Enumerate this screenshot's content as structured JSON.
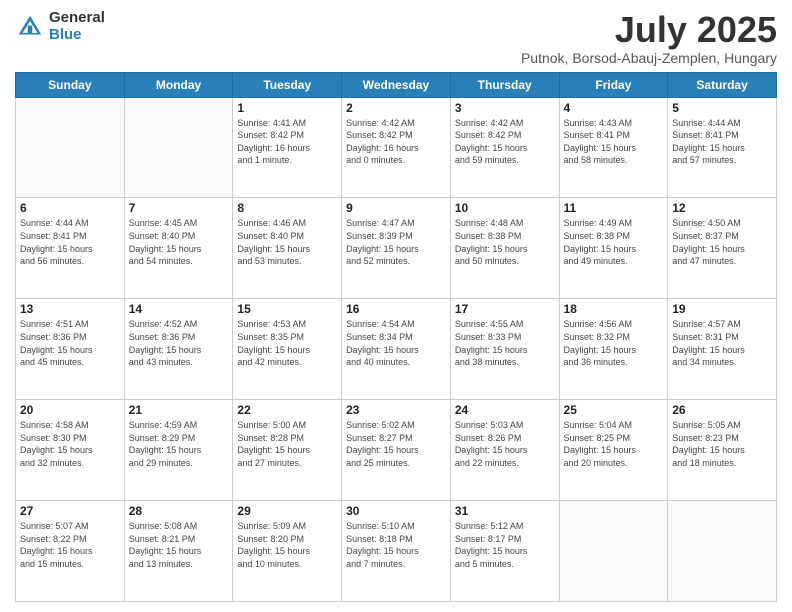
{
  "header": {
    "logo_general": "General",
    "logo_blue": "Blue",
    "title": "July 2025",
    "location": "Putnok, Borsod-Abauj-Zemplen, Hungary"
  },
  "days_of_week": [
    "Sunday",
    "Monday",
    "Tuesday",
    "Wednesday",
    "Thursday",
    "Friday",
    "Saturday"
  ],
  "weeks": [
    [
      {
        "day": "",
        "info": ""
      },
      {
        "day": "",
        "info": ""
      },
      {
        "day": "1",
        "info": "Sunrise: 4:41 AM\nSunset: 8:42 PM\nDaylight: 16 hours\nand 1 minute."
      },
      {
        "day": "2",
        "info": "Sunrise: 4:42 AM\nSunset: 8:42 PM\nDaylight: 16 hours\nand 0 minutes."
      },
      {
        "day": "3",
        "info": "Sunrise: 4:42 AM\nSunset: 8:42 PM\nDaylight: 15 hours\nand 59 minutes."
      },
      {
        "day": "4",
        "info": "Sunrise: 4:43 AM\nSunset: 8:41 PM\nDaylight: 15 hours\nand 58 minutes."
      },
      {
        "day": "5",
        "info": "Sunrise: 4:44 AM\nSunset: 8:41 PM\nDaylight: 15 hours\nand 57 minutes."
      }
    ],
    [
      {
        "day": "6",
        "info": "Sunrise: 4:44 AM\nSunset: 8:41 PM\nDaylight: 15 hours\nand 56 minutes."
      },
      {
        "day": "7",
        "info": "Sunrise: 4:45 AM\nSunset: 8:40 PM\nDaylight: 15 hours\nand 54 minutes."
      },
      {
        "day": "8",
        "info": "Sunrise: 4:46 AM\nSunset: 8:40 PM\nDaylight: 15 hours\nand 53 minutes."
      },
      {
        "day": "9",
        "info": "Sunrise: 4:47 AM\nSunset: 8:39 PM\nDaylight: 15 hours\nand 52 minutes."
      },
      {
        "day": "10",
        "info": "Sunrise: 4:48 AM\nSunset: 8:38 PM\nDaylight: 15 hours\nand 50 minutes."
      },
      {
        "day": "11",
        "info": "Sunrise: 4:49 AM\nSunset: 8:38 PM\nDaylight: 15 hours\nand 49 minutes."
      },
      {
        "day": "12",
        "info": "Sunrise: 4:50 AM\nSunset: 8:37 PM\nDaylight: 15 hours\nand 47 minutes."
      }
    ],
    [
      {
        "day": "13",
        "info": "Sunrise: 4:51 AM\nSunset: 8:36 PM\nDaylight: 15 hours\nand 45 minutes."
      },
      {
        "day": "14",
        "info": "Sunrise: 4:52 AM\nSunset: 8:36 PM\nDaylight: 15 hours\nand 43 minutes."
      },
      {
        "day": "15",
        "info": "Sunrise: 4:53 AM\nSunset: 8:35 PM\nDaylight: 15 hours\nand 42 minutes."
      },
      {
        "day": "16",
        "info": "Sunrise: 4:54 AM\nSunset: 8:34 PM\nDaylight: 15 hours\nand 40 minutes."
      },
      {
        "day": "17",
        "info": "Sunrise: 4:55 AM\nSunset: 8:33 PM\nDaylight: 15 hours\nand 38 minutes."
      },
      {
        "day": "18",
        "info": "Sunrise: 4:56 AM\nSunset: 8:32 PM\nDaylight: 15 hours\nand 36 minutes."
      },
      {
        "day": "19",
        "info": "Sunrise: 4:57 AM\nSunset: 8:31 PM\nDaylight: 15 hours\nand 34 minutes."
      }
    ],
    [
      {
        "day": "20",
        "info": "Sunrise: 4:58 AM\nSunset: 8:30 PM\nDaylight: 15 hours\nand 32 minutes."
      },
      {
        "day": "21",
        "info": "Sunrise: 4:59 AM\nSunset: 8:29 PM\nDaylight: 15 hours\nand 29 minutes."
      },
      {
        "day": "22",
        "info": "Sunrise: 5:00 AM\nSunset: 8:28 PM\nDaylight: 15 hours\nand 27 minutes."
      },
      {
        "day": "23",
        "info": "Sunrise: 5:02 AM\nSunset: 8:27 PM\nDaylight: 15 hours\nand 25 minutes."
      },
      {
        "day": "24",
        "info": "Sunrise: 5:03 AM\nSunset: 8:26 PM\nDaylight: 15 hours\nand 22 minutes."
      },
      {
        "day": "25",
        "info": "Sunrise: 5:04 AM\nSunset: 8:25 PM\nDaylight: 15 hours\nand 20 minutes."
      },
      {
        "day": "26",
        "info": "Sunrise: 5:05 AM\nSunset: 8:23 PM\nDaylight: 15 hours\nand 18 minutes."
      }
    ],
    [
      {
        "day": "27",
        "info": "Sunrise: 5:07 AM\nSunset: 8:22 PM\nDaylight: 15 hours\nand 15 minutes."
      },
      {
        "day": "28",
        "info": "Sunrise: 5:08 AM\nSunset: 8:21 PM\nDaylight: 15 hours\nand 13 minutes."
      },
      {
        "day": "29",
        "info": "Sunrise: 5:09 AM\nSunset: 8:20 PM\nDaylight: 15 hours\nand 10 minutes."
      },
      {
        "day": "30",
        "info": "Sunrise: 5:10 AM\nSunset: 8:18 PM\nDaylight: 15 hours\nand 7 minutes."
      },
      {
        "day": "31",
        "info": "Sunrise: 5:12 AM\nSunset: 8:17 PM\nDaylight: 15 hours\nand 5 minutes."
      },
      {
        "day": "",
        "info": ""
      },
      {
        "day": "",
        "info": ""
      }
    ]
  ]
}
